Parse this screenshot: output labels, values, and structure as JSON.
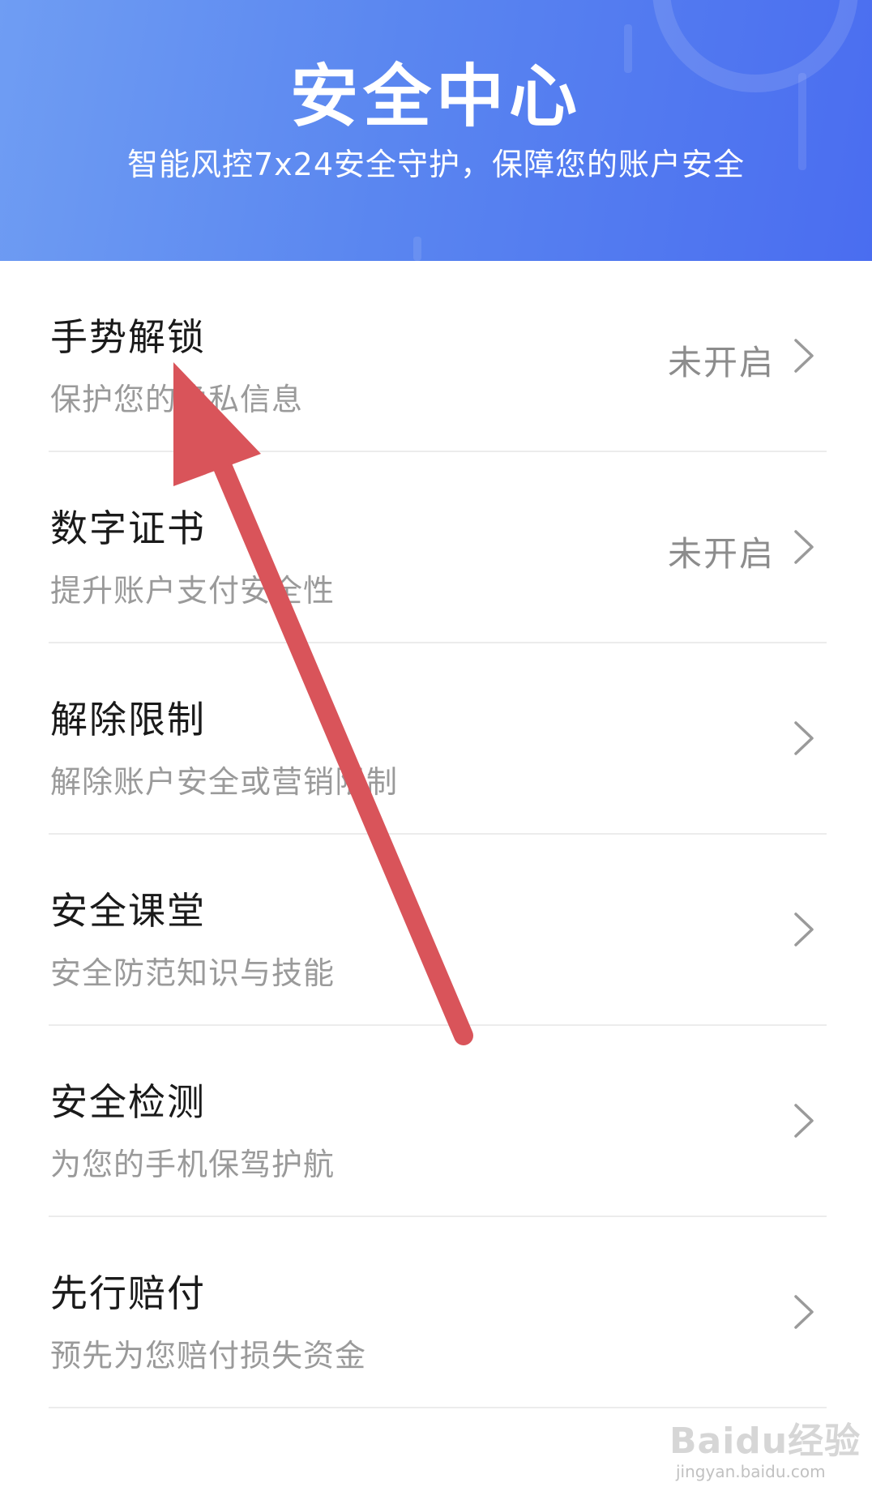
{
  "header": {
    "title": "安全中心",
    "subtitle": "智能风控7x24安全守护，保障您的账户安全"
  },
  "items": [
    {
      "title": "手势解锁",
      "desc": "保护您的隐私信息",
      "status": "未开启"
    },
    {
      "title": "数字证书",
      "desc": "提升账户支付安全性",
      "status": "未开启"
    },
    {
      "title": "解除限制",
      "desc": "解除账户安全或营销限制",
      "status": ""
    },
    {
      "title": "安全课堂",
      "desc": "安全防范知识与技能",
      "status": ""
    },
    {
      "title": "安全检测",
      "desc": "为您的手机保驾护航",
      "status": ""
    },
    {
      "title": "先行赔付",
      "desc": "预先为您赔付损失资金",
      "status": ""
    }
  ],
  "watermark": {
    "main": "Baidu经验",
    "sub": "jingyan.baidu.com"
  },
  "colors": {
    "header_gradient_start": "#6f9df3",
    "header_gradient_end": "#4a6df0",
    "annotation_arrow": "#d9545a"
  },
  "icons": {
    "chevron": "chevron-right-icon",
    "annotation": "red-arrow-annotation"
  }
}
